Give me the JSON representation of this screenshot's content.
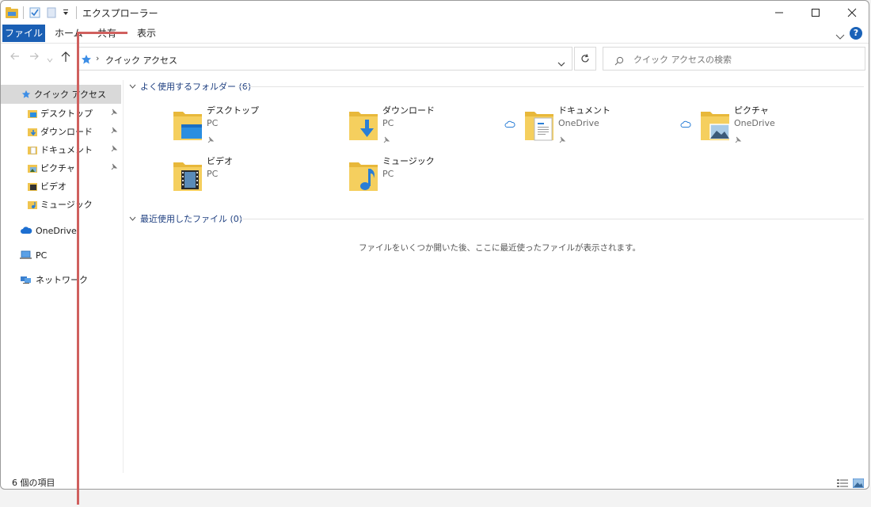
{
  "window": {
    "title": "エクスプローラー"
  },
  "ribbon": {
    "tabs": [
      {
        "label": "ファイル"
      },
      {
        "label": "ホーム"
      },
      {
        "label": "共有"
      },
      {
        "label": "表示"
      }
    ],
    "help": "?"
  },
  "address": {
    "breadcrumb": "クイック アクセス"
  },
  "search": {
    "placeholder": "クイック アクセスの検索"
  },
  "sidebar": {
    "items": [
      {
        "label": "クイック アクセス",
        "icon": "star-icon",
        "selected": true
      },
      {
        "label": "デスクトップ",
        "icon": "desktop-folder-icon",
        "pinned": true
      },
      {
        "label": "ダウンロード",
        "icon": "downloads-folder-icon",
        "pinned": true
      },
      {
        "label": "ドキュメント",
        "icon": "documents-folder-icon",
        "pinned": true
      },
      {
        "label": "ピクチャ",
        "icon": "pictures-folder-icon",
        "pinned": true
      },
      {
        "label": "ビデオ",
        "icon": "videos-folder-icon"
      },
      {
        "label": "ミュージック",
        "icon": "music-folder-icon"
      },
      {
        "label": "OneDrive",
        "icon": "onedrive-cloud-icon"
      },
      {
        "label": "PC",
        "icon": "pc-icon"
      },
      {
        "label": "ネットワーク",
        "icon": "network-icon"
      }
    ]
  },
  "frequent": {
    "header": "よく使用するフォルダー (6)",
    "folders": [
      {
        "name": "デスクトップ",
        "location": "PC",
        "pinned": true
      },
      {
        "name": "ダウンロード",
        "location": "PC",
        "pinned": true
      },
      {
        "name": "ドキュメント",
        "location": "OneDrive",
        "pinned": true,
        "cloud": true
      },
      {
        "name": "ピクチャ",
        "location": "OneDrive",
        "pinned": true,
        "cloud": true
      },
      {
        "name": "ビデオ",
        "location": "PC"
      },
      {
        "name": "ミュージック",
        "location": "PC"
      }
    ]
  },
  "recent": {
    "header": "最近使用したファイル (0)",
    "empty_message": "ファイルをいくつか開いた後、ここに最近使ったファイルが表示されます。"
  },
  "status": {
    "item_count": "6 個の項目"
  },
  "colors": {
    "accent": "#1a5fb4",
    "folder": "#f0c550",
    "callout": "#d0605e"
  }
}
